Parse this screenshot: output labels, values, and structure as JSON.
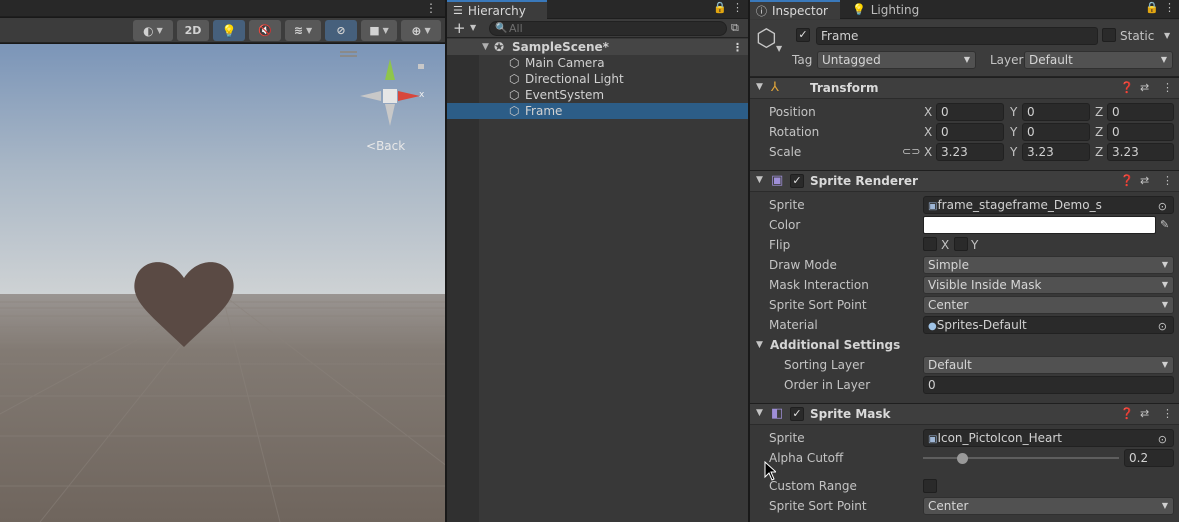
{
  "scene": {
    "toolbar": {
      "mode_2d": "2D"
    },
    "gizmo": {
      "x_label": "x",
      "back_label": "Back"
    }
  },
  "hierarchy": {
    "tab_label": "Hierarchy",
    "search_placeholder": "All",
    "scene_name": "SampleScene*",
    "items": [
      {
        "label": "Main Camera"
      },
      {
        "label": "Directional Light"
      },
      {
        "label": "EventSystem"
      },
      {
        "label": "Frame"
      }
    ]
  },
  "inspector": {
    "tabs": {
      "inspector": "Inspector",
      "lighting": "Lighting"
    },
    "object_name": "Frame",
    "static_label": "Static",
    "tag_label": "Tag",
    "tag_value": "Untagged",
    "layer_label": "Layer",
    "layer_value": "Default",
    "transform": {
      "title": "Transform",
      "position_label": "Position",
      "rotation_label": "Rotation",
      "scale_label": "Scale",
      "axis_x": "X",
      "axis_y": "Y",
      "axis_z": "Z",
      "position": {
        "x": "0",
        "y": "0",
        "z": "0"
      },
      "rotation": {
        "x": "0",
        "y": "0",
        "z": "0"
      },
      "scale": {
        "x": "3.23",
        "y": "3.23",
        "z": "3.23"
      }
    },
    "sprite_renderer": {
      "title": "Sprite Renderer",
      "sprite_label": "Sprite",
      "sprite_value": "frame_stageframe_Demo_s",
      "color_label": "Color",
      "color_value": "#ffffff",
      "flip_label": "Flip",
      "flip_x": "X",
      "flip_y": "Y",
      "draw_mode_label": "Draw Mode",
      "draw_mode_value": "Simple",
      "mask_interaction_label": "Mask Interaction",
      "mask_interaction_value": "Visible Inside Mask",
      "sort_point_label": "Sprite Sort Point",
      "sort_point_value": "Center",
      "material_label": "Material",
      "material_value": "Sprites-Default",
      "additional_settings_label": "Additional Settings",
      "sorting_layer_label": "Sorting Layer",
      "sorting_layer_value": "Default",
      "order_in_layer_label": "Order in Layer",
      "order_in_layer_value": "0"
    },
    "sprite_mask": {
      "title": "Sprite Mask",
      "sprite_label": "Sprite",
      "sprite_value": "Icon_PictoIcon_Heart",
      "alpha_cutoff_label": "Alpha Cutoff",
      "alpha_cutoff_value": "0.2",
      "alpha_cutoff_fraction": 0.2,
      "custom_range_label": "Custom Range",
      "sort_point_label": "Sprite Sort Point",
      "sort_point_value": "Center"
    }
  },
  "colors": {
    "selection": "#2c5d87",
    "accent_tab": "#3a79bb",
    "axis_x": "#d8473c",
    "axis_y": "#8fc54b",
    "heart": "#5a4a44"
  }
}
